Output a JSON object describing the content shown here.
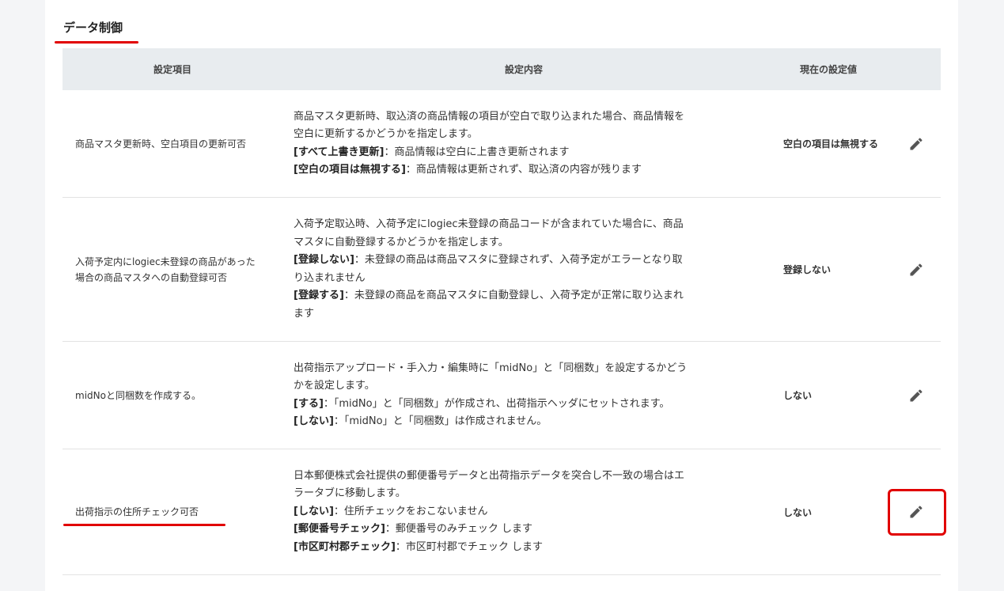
{
  "section": {
    "title": "データ制御"
  },
  "table": {
    "headers": {
      "item": "設定項目",
      "content": "設定内容",
      "current": "現在の設定値"
    },
    "rows": [
      {
        "name": [
          "商品マスタ更新時、空白項目の更新可否"
        ],
        "desc": [
          {
            "b": "",
            "t": "商品マスタ更新時、取込済の商品情報の項目が空白で取り込まれた場合、商品情報を"
          },
          {
            "b": "",
            "t": "空白に更新するかどうかを指定します。"
          },
          {
            "b": "[すべて上書き更新]",
            "t": "：商品情報は空白に上書き更新されます"
          },
          {
            "b": "[空白の項目は無視する]",
            "t": "：商品情報は更新されず、取込済の内容が残ります"
          }
        ],
        "value": "空白の項目は無視する"
      },
      {
        "name": [
          "入荷予定内にlogiec未登録の商品があった",
          "場合の商品マスタへの自動登録可否"
        ],
        "desc": [
          {
            "b": "",
            "t": "入荷予定取込時、入荷予定にlogiec未登録の商品コードが含まれていた場合に、商品"
          },
          {
            "b": "",
            "t": "マスタに自動登録するかどうかを指定します。"
          },
          {
            "b": "[登録しない]",
            "t": "：未登録の商品は商品マスタに登録されず、入荷予定がエラーとなり取"
          },
          {
            "b": "",
            "t": "り込まれません"
          },
          {
            "b": "[登録する]",
            "t": "：未登録の商品を商品マスタに自動登録し、入荷予定が正常に取り込まれ"
          },
          {
            "b": "",
            "t": "ます"
          }
        ],
        "value": "登録しない"
      },
      {
        "name": [
          "midNoと同梱数を作成する。"
        ],
        "desc": [
          {
            "b": "",
            "t": "出荷指示アップロード・手入力・編集時に「midNo」と「同梱数」を設定するかどう"
          },
          {
            "b": "",
            "t": "かを設定します。"
          },
          {
            "b": "[する]",
            "t": "：「midNo」と「同梱数」が作成され、出荷指示ヘッダにセットされます。"
          },
          {
            "b": "[しない]",
            "t": "：「midNo」と「同梱数」は作成されません。"
          }
        ],
        "value": "しない"
      },
      {
        "name": [
          "出荷指示の住所チェック可否"
        ],
        "desc": [
          {
            "b": "",
            "t": "日本郵便株式会社提供の郵便番号データと出荷指示データを突合し不一致の場合はエ"
          },
          {
            "b": "",
            "t": "ラータブに移動します。"
          },
          {
            "b": "[しない]",
            "t": "：住所チェックをおこないません"
          },
          {
            "b": "[郵便番号チェック]",
            "t": "：郵便番号のみチェック します"
          },
          {
            "b": "[市区町村郡チェック]",
            "t": "：市区町村郡でチェック します"
          }
        ],
        "value": "しない"
      }
    ]
  },
  "icons": {
    "edit": "pencil-icon"
  },
  "colors": {
    "accent_red": "#e10000",
    "header_bg": "#e8ecef"
  }
}
